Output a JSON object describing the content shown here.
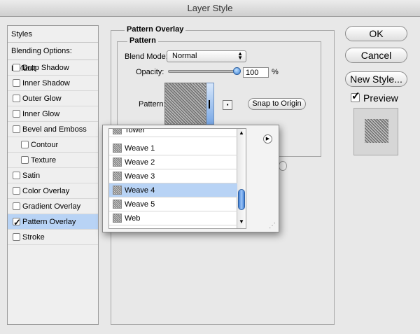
{
  "window": {
    "title": "Layer Style"
  },
  "styles_panel": {
    "header": "Styles",
    "blending_options": "Blending Options: Default",
    "items": [
      {
        "label": "Drop Shadow",
        "checked": false,
        "indent": false,
        "selected": false
      },
      {
        "label": "Inner Shadow",
        "checked": false,
        "indent": false,
        "selected": false
      },
      {
        "label": "Outer Glow",
        "checked": false,
        "indent": false,
        "selected": false
      },
      {
        "label": "Inner Glow",
        "checked": false,
        "indent": false,
        "selected": false
      },
      {
        "label": "Bevel and Emboss",
        "checked": false,
        "indent": false,
        "selected": false
      },
      {
        "label": "Contour",
        "checked": false,
        "indent": true,
        "selected": false
      },
      {
        "label": "Texture",
        "checked": false,
        "indent": true,
        "selected": false
      },
      {
        "label": "Satin",
        "checked": false,
        "indent": false,
        "selected": false
      },
      {
        "label": "Color Overlay",
        "checked": false,
        "indent": false,
        "selected": false
      },
      {
        "label": "Gradient Overlay",
        "checked": false,
        "indent": false,
        "selected": false
      },
      {
        "label": "Pattern Overlay",
        "checked": true,
        "indent": false,
        "selected": true
      },
      {
        "label": "Stroke",
        "checked": false,
        "indent": false,
        "selected": false
      }
    ]
  },
  "pattern_overlay": {
    "section_title": "Pattern Overlay",
    "group_title": "Pattern",
    "blend_mode_label": "Blend Mode:",
    "blend_mode_value": "Normal",
    "opacity_label": "Opacity:",
    "opacity_value": "100",
    "opacity_unit": "%",
    "opacity_fraction": 1.0,
    "pattern_label": "Pattern:",
    "snap_button": "Snap to Origin"
  },
  "buttons": {
    "ok": "OK",
    "cancel": "Cancel",
    "new_style": "New Style...",
    "preview_label": "Preview"
  },
  "pattern_picker": {
    "partial_top": "Tower",
    "items": [
      "Weave 1",
      "Weave 2",
      "Weave 3",
      "Weave 4",
      "Weave 5",
      "Web"
    ],
    "selected": "Weave 4"
  },
  "colors": {
    "selection": "#b8d3f5",
    "accent": "#3f7ed6"
  }
}
